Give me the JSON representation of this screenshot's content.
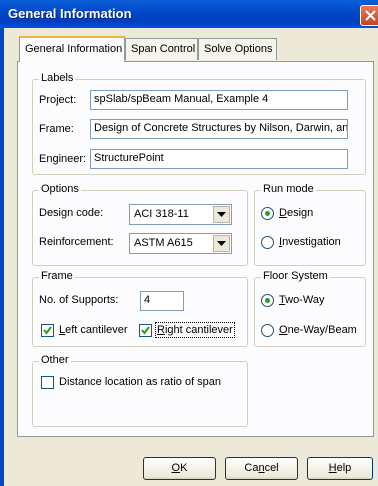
{
  "window": {
    "title": "General Information"
  },
  "tabs": [
    "General Information",
    "Span Control",
    "Solve Options"
  ],
  "labels_group": {
    "title": "Labels",
    "project_label": "Project:",
    "project_value": "spSlab/spBeam Manual, Example 4",
    "frame_label": "Frame:",
    "frame_value": "Design of Concrete Structures by Nilson, Darwin, an",
    "engineer_label": "Engineer:",
    "engineer_value": "StructurePoint"
  },
  "options_group": {
    "title": "Options",
    "design_code_label": "Design code:",
    "design_code_value": "ACI 318-11",
    "reinforcement_label": "Reinforcement:",
    "reinforcement_value": "ASTM A615"
  },
  "run_mode": {
    "title": "Run mode",
    "design": "Design",
    "investigation": "Investigation",
    "selected": "Design"
  },
  "frame_group": {
    "title": "Frame",
    "supports_label": "No. of Supports:",
    "supports_value": "4",
    "left_cantilever": "Left cantilever",
    "left_checked": true,
    "right_cantilever": "Right cantilever",
    "right_checked": true
  },
  "floor_system": {
    "title": "Floor System",
    "two_way": "Two-Way",
    "one_way": "One-Way/Beam",
    "selected": "Two-Way"
  },
  "other_group": {
    "title": "Other",
    "distance_label": "Distance location as ratio of span",
    "distance_checked": false
  },
  "buttons": {
    "ok": "OK",
    "cancel": "Cancel",
    "help": "Help"
  }
}
